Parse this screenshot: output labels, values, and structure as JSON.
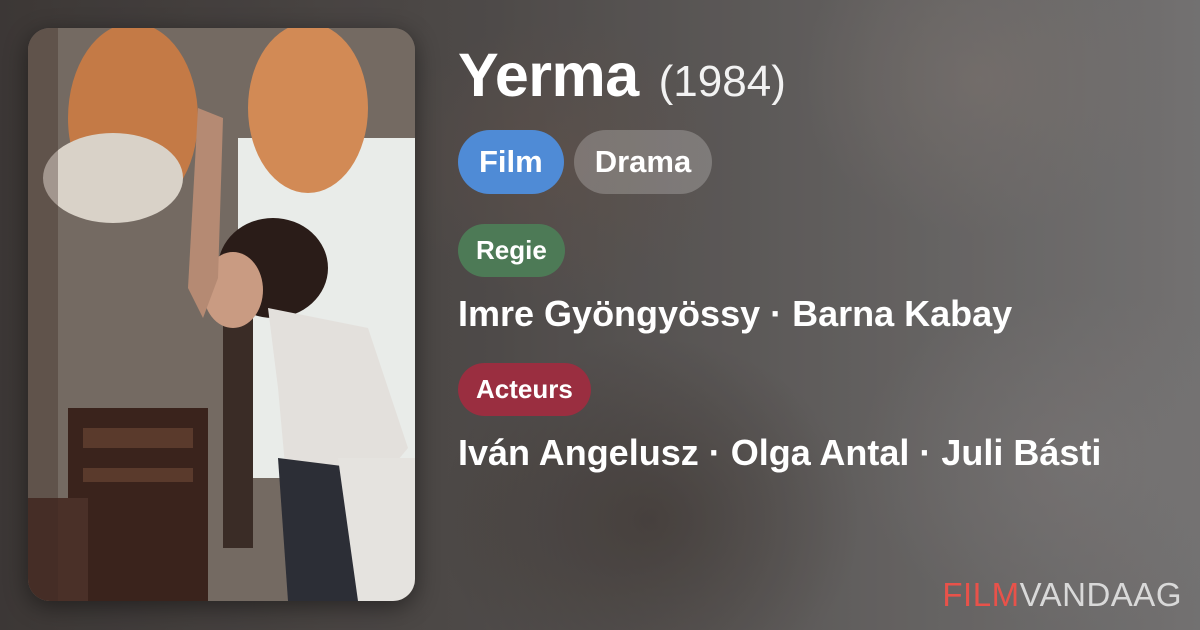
{
  "movie": {
    "title": "Yerma",
    "year": "(1984)"
  },
  "genres": {
    "type_label": "Film",
    "genre_label": "Drama"
  },
  "credits": {
    "director_label": "Regie",
    "directors": "Imre Gyöngyössy · Barna Kabay",
    "actors_label": "Acteurs",
    "actors": "Iván Angelusz · Olga Antal · Juli Básti"
  },
  "brand": {
    "logo_part1": "FILM",
    "logo_part2": "VANDAAG"
  },
  "colors": {
    "film_pill": "#4f8bd6",
    "regie_label": "#4d7a56",
    "acteurs_label": "#9a2e40",
    "logo_accent": "#e8524a"
  }
}
